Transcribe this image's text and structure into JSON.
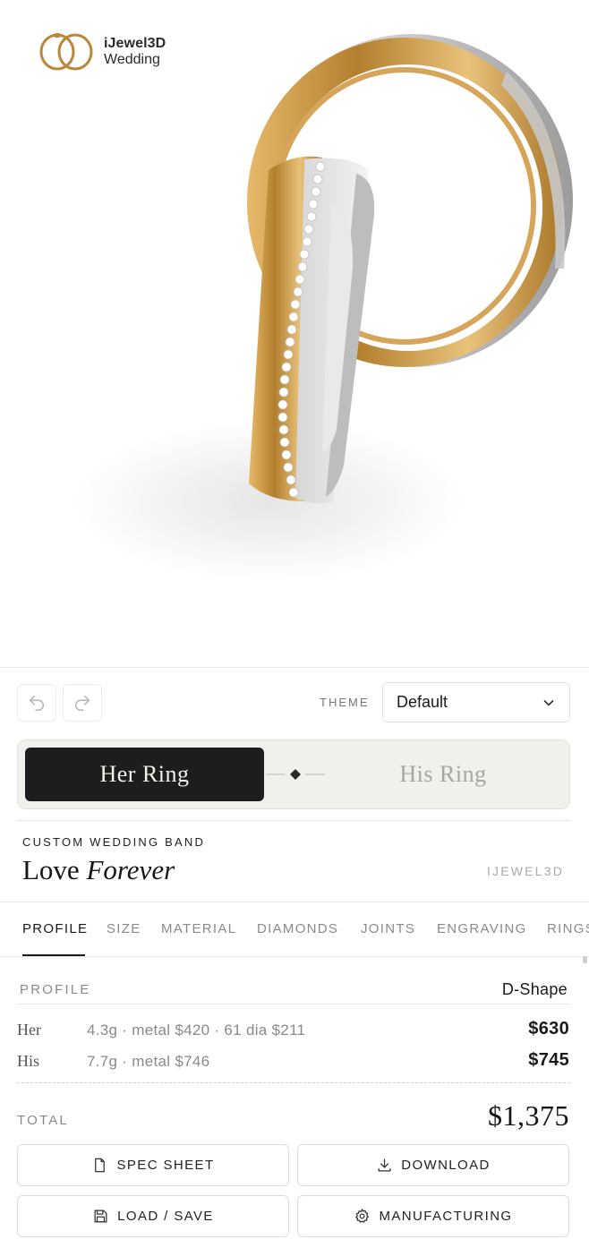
{
  "brand": {
    "name": "iJewel3D",
    "sub": "Wedding"
  },
  "toolbar": {
    "undo_icon": "undo-icon",
    "redo_icon": "redo-icon",
    "theme_label": "THEME",
    "theme_value": "Default"
  },
  "ring_toggle": {
    "her": "Her Ring",
    "his": "His Ring",
    "selected": "Her Ring"
  },
  "product": {
    "eyebrow": "CUSTOM WEDDING BAND",
    "title_main": "Love",
    "title_italic": "Forever",
    "brand_tag": "IJEWEL3D"
  },
  "tabs": [
    "PROFILE",
    "SIZE",
    "MATERIAL",
    "DIAMONDS",
    "JOINTS",
    "ENGRAVING",
    "RINGS"
  ],
  "active_tab": "PROFILE",
  "profile": {
    "label": "PROFILE",
    "value": "D-Shape"
  },
  "pricing": {
    "her": {
      "label": "Her",
      "detail": "4.3g · metal $420 · 61 dia $211",
      "price": "$630"
    },
    "his": {
      "label": "His",
      "detail": "7.7g · metal $746",
      "price": "$745"
    },
    "total_label": "TOTAL",
    "total_value": "$1,375"
  },
  "actions": {
    "spec_sheet": "SPEC SHEET",
    "download": "DOWNLOAD",
    "load_save": "LOAD / SAVE",
    "manufacturing": "MANUFACTURING"
  },
  "colors": {
    "gold": "#c99a4a",
    "white_gold": "#d9d9d9",
    "dark": "#1d1d1d",
    "toggle_bg": "#f2f0ec"
  }
}
